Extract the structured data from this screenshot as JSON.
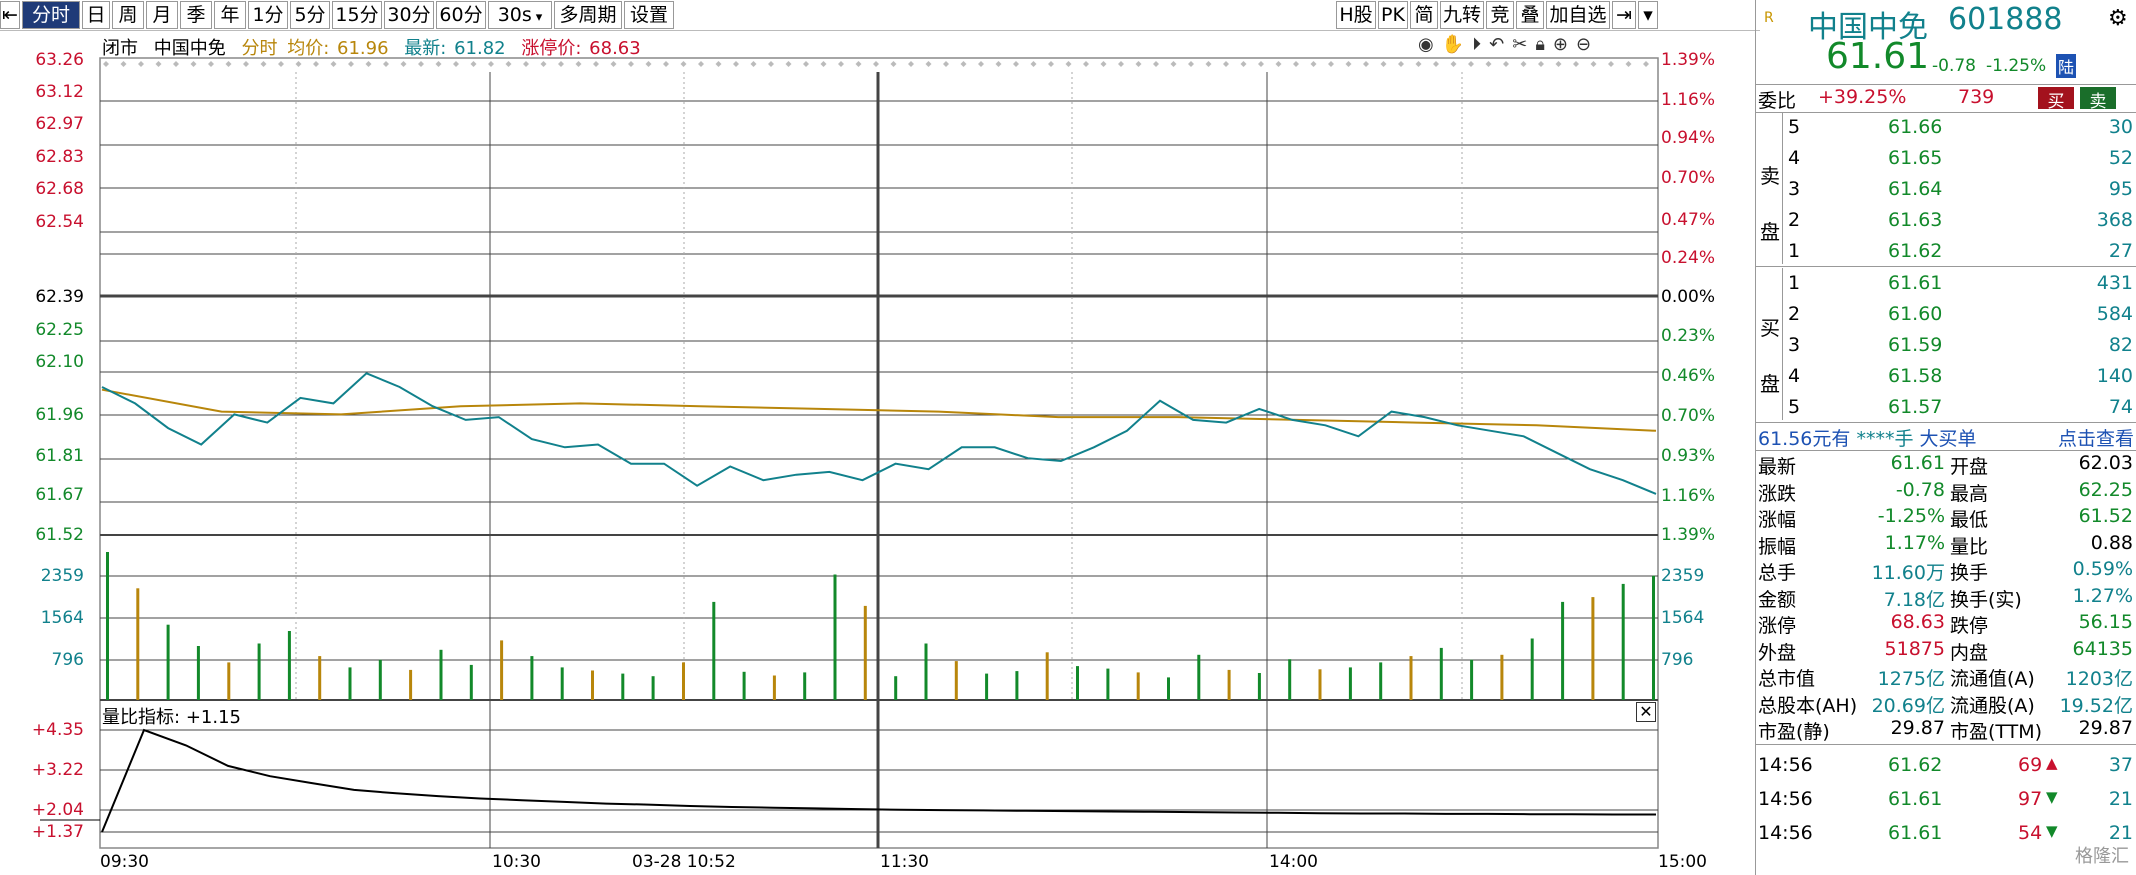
{
  "toolbar": {
    "items": [
      "分时",
      "日",
      "周",
      "月",
      "季",
      "年",
      "1分",
      "5分",
      "15分",
      "30分",
      "60分",
      "30s",
      "多周期",
      "设置"
    ],
    "right_items": [
      "H股",
      "PK",
      "简",
      "九转",
      "竞",
      "叠",
      "加自选"
    ]
  },
  "ticker": {
    "status": "闭市",
    "name": "中国中免",
    "mode": "分时",
    "avg_label": "均价:",
    "avg": "61.96",
    "latest_label": "最新:",
    "latest": "61.82",
    "limit_label": "涨停价:",
    "limit": "68.63"
  },
  "price_axis": {
    "left": [
      "63.26",
      "63.12",
      "62.97",
      "62.83",
      "62.68",
      "62.54",
      "62.39",
      "62.25",
      "62.10",
      "61.96",
      "61.81",
      "61.67",
      "61.52"
    ],
    "right": [
      "1.39%",
      "1.16%",
      "0.94%",
      "0.70%",
      "0.47%",
      "0.24%",
      "0.00%",
      "0.23%",
      "0.46%",
      "0.70%",
      "0.93%",
      "1.16%",
      "1.39%"
    ]
  },
  "volume_axis": {
    "labels": [
      "2359",
      "1564",
      "796"
    ]
  },
  "indicator": {
    "label": "量比指标:",
    "value": "+1.15",
    "axis": [
      "+4.35",
      "+3.22",
      "+2.04",
      "+1.37"
    ]
  },
  "time_axis": [
    "09:30",
    "10:30",
    "03-28 10:52",
    "11:30",
    "14:00",
    "15:00"
  ],
  "chart_data": {
    "type": "line",
    "title": "",
    "xlabel": "",
    "ylabel": "",
    "ylim": [
      61.52,
      63.26
    ],
    "x": [
      "09:30",
      "10:30",
      "11:30",
      "14:00",
      "15:00"
    ],
    "series": [
      {
        "values": [
          62.06,
          62.0,
          61.91,
          61.85,
          61.96,
          61.93,
          62.02,
          62.0,
          62.11,
          62.06,
          61.99,
          61.94,
          61.95,
          61.87,
          61.84,
          61.85,
          61.78,
          61.78,
          61.7,
          61.77,
          61.72,
          61.74,
          61.75,
          61.72,
          61.78,
          61.76,
          61.84,
          61.84,
          61.8,
          61.79,
          61.84,
          61.9,
          62.01,
          61.94,
          61.93,
          61.98,
          61.94,
          61.92,
          61.88,
          61.97,
          61.95,
          61.92,
          61.9,
          61.88,
          61.82,
          61.76,
          61.72,
          61.67
        ]
      },
      {
        "values": [
          62.05,
          61.97,
          61.96,
          61.99,
          62.0,
          61.99,
          61.98,
          61.97,
          61.95,
          61.95,
          61.94,
          61.93,
          61.92,
          61.9
        ]
      }
    ],
    "volume": [
      2359,
      1780,
      1200,
      860,
      600,
      900,
      1100,
      700,
      520,
      640,
      480,
      800,
      560,
      950,
      700,
      520,
      470,
      420,
      380,
      600,
      1564,
      450,
      390,
      440,
      2000,
      1500,
      380,
      900,
      620,
      420,
      460,
      760,
      540,
      500,
      440,
      360,
      720,
      480,
      430,
      650,
      490,
      520,
      600,
      700,
      830,
      640,
      720,
      980,
      1564,
      1640,
      1850,
      1980
    ],
    "ratio": [
      1.37,
      4.35,
      3.9,
      3.3,
      3.0,
      2.8,
      2.6,
      2.5,
      2.42,
      2.35,
      2.3,
      2.25,
      2.2,
      2.17,
      2.13,
      2.1,
      2.08,
      2.06,
      2.04,
      2.02,
      2.01,
      2.0,
      1.99,
      1.98,
      1.97,
      1.96,
      1.95,
      1.94,
      1.93,
      1.92,
      1.91,
      1.91,
      1.9,
      1.9,
      1.89,
      1.89,
      1.88,
      1.88
    ]
  },
  "quote_panel": {
    "logo": "R",
    "name": "中国中免",
    "code": "601888",
    "price": "61.61",
    "change": "-0.78",
    "pct": "-1.25%",
    "tag": "陆",
    "weibi_label": "委比",
    "weibi": "+39.25%",
    "weicha": "739",
    "buy_btn": "买",
    "sell_btn": "卖",
    "sell_label": [
      "卖",
      "盘"
    ],
    "buy_label": [
      "买",
      "盘"
    ],
    "sells": [
      {
        "lvl": "5",
        "price": "61.66",
        "vol": "30"
      },
      {
        "lvl": "4",
        "price": "61.65",
        "vol": "52"
      },
      {
        "lvl": "3",
        "price": "61.64",
        "vol": "95"
      },
      {
        "lvl": "2",
        "price": "61.63",
        "vol": "368"
      },
      {
        "lvl": "1",
        "price": "61.62",
        "vol": "27"
      }
    ],
    "buys": [
      {
        "lvl": "1",
        "price": "61.61",
        "vol": "431"
      },
      {
        "lvl": "2",
        "price": "61.60",
        "vol": "584"
      },
      {
        "lvl": "3",
        "price": "61.59",
        "vol": "82"
      },
      {
        "lvl": "4",
        "price": "61.58",
        "vol": "140"
      },
      {
        "lvl": "5",
        "price": "61.57",
        "vol": "74"
      }
    ],
    "bigorder": {
      "price": "61.56元有",
      "vol": "****手",
      "label": "大买单",
      "link": "点击查看"
    },
    "stats": [
      {
        "k1": "最新",
        "v1": "61.61",
        "k2": "开盘",
        "v2": "62.03"
      },
      {
        "k1": "涨跌",
        "v1": "-0.78",
        "k2": "最高",
        "v2": "62.25"
      },
      {
        "k1": "涨幅",
        "v1": "-1.25%",
        "k2": "最低",
        "v2": "61.52"
      },
      {
        "k1": "振幅",
        "v1": "1.17%",
        "k2": "量比",
        "v2": "0.88"
      },
      {
        "k1": "总手",
        "v1": "11.60万",
        "k2": "换手",
        "v2": "0.59%"
      },
      {
        "k1": "金额",
        "v1": "7.18亿",
        "k2": "换手(实)",
        "v2": "1.27%"
      },
      {
        "k1": "涨停",
        "v1": "68.63",
        "k2": "跌停",
        "v2": "56.15"
      },
      {
        "k1": "外盘",
        "v1": "51875",
        "k2": "内盘",
        "v2": "64135"
      },
      {
        "k1": "总市值",
        "v1": "1275亿",
        "k2": "流通值(A)",
        "v2": "1203亿"
      },
      {
        "k1": "总股本(AH)",
        "v1": "20.69亿",
        "k2": "流通股(A)",
        "v2": "19.52亿"
      },
      {
        "k1": "市盈(静)",
        "v1": "29.87",
        "k2": "市盈(TTM)",
        "v2": "29.87"
      }
    ],
    "trades": [
      {
        "t": "14:56",
        "p": "61.62",
        "v": "69",
        "a": "▲",
        "n": "37"
      },
      {
        "t": "14:56",
        "p": "61.61",
        "v": "97",
        "a": "▼",
        "n": "21"
      },
      {
        "t": "14:56",
        "p": "61.61",
        "v": "54",
        "a": "▼",
        "n": "21"
      }
    ],
    "watermark": "格隆汇"
  },
  "colors": {
    "up": "#c8102e",
    "down": "#12892a",
    "teal": "#11818c",
    "avg": "#b8860b"
  }
}
